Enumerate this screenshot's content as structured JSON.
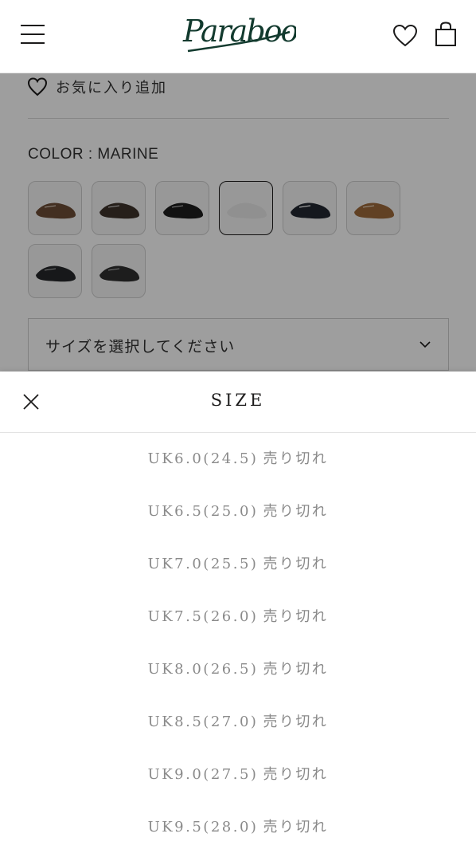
{
  "header": {
    "logo_text": "Paraboot"
  },
  "product": {
    "favorite_label": "お気に入り追加",
    "color_label": "COLOR : MARINE",
    "size_select_placeholder": "サイズを選択してください"
  },
  "size_sheet": {
    "title": "SIZE",
    "sizes": [
      {
        "code": "UK6.0(24.5)",
        "status": "売り切れ"
      },
      {
        "code": "UK6.5(25.0)",
        "status": "売り切れ"
      },
      {
        "code": "UK7.0(25.5)",
        "status": "売り切れ"
      },
      {
        "code": "UK7.5(26.0)",
        "status": "売り切れ"
      },
      {
        "code": "UK8.0(26.5)",
        "status": "売り切れ"
      },
      {
        "code": "UK8.5(27.0)",
        "status": "売り切れ"
      },
      {
        "code": "UK9.0(27.5)",
        "status": "売り切れ"
      },
      {
        "code": "UK9.5(28.0)",
        "status": "売り切れ"
      }
    ]
  },
  "colors": {
    "brand_green": "#123a2e",
    "overlay": "rgba(0,0,0,0.38)"
  }
}
